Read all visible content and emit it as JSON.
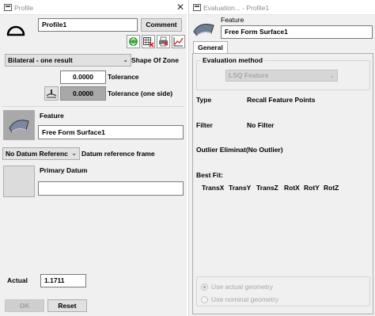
{
  "profile": {
    "title": "Profile",
    "name_value": "Profile1",
    "comment_label": "Comment",
    "shape_zone_select": "Bilateral - one result",
    "shape_zone_label": "Shape Of Zone",
    "tolerance_value": "0.0000",
    "tolerance_label": "Tolerance",
    "tolerance_one_side_value": "0.0000",
    "tolerance_one_side_label": "Tolerance (one side)",
    "feature_label": "Feature",
    "feature_value": "Free Form Surface1",
    "datum_select": "No Datum Referenc",
    "datum_ref_label": "Datum reference frame",
    "primary_datum_label": "Primary Datum",
    "primary_datum_value": "",
    "actual_label": "Actual",
    "actual_value": "1.1711",
    "ok_label": "OK",
    "reset_label": "Reset"
  },
  "evaluation": {
    "title": "Evaluation... - Profile1",
    "feature_label": "Feature",
    "feature_value": "Free Form Surface1",
    "tab_general": "General",
    "eval_method_label": "Evaluation method",
    "eval_method_select": "LSQ Feature",
    "type_label": "Type",
    "type_value": "Recall Feature Points",
    "filter_label": "Filter",
    "filter_value": "No Filter",
    "outlier_label": "Outlier Eliminat(No Outlier)",
    "bestfit_label": "Best Fit:",
    "bestfit_options": [
      "TransX",
      "TransY",
      "TransZ",
      "RotX",
      "RotY",
      "RotZ"
    ],
    "radio_actual": "Use actual geometry",
    "radio_nominal": "Use nominal geometry"
  },
  "colors": {
    "window_bg": "#f0f0f0",
    "title_text": "#8b8b8b",
    "disabled_text": "#a0a0a0"
  }
}
